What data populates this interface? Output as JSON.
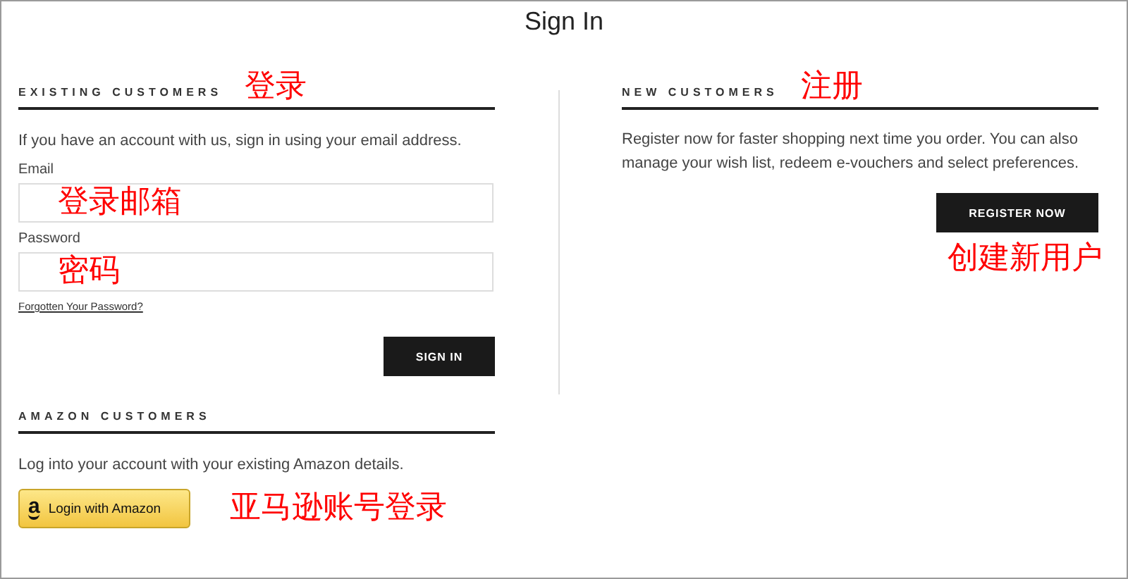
{
  "page_title": "Sign In",
  "existing": {
    "heading": "EXISTING CUSTOMERS",
    "annotation": "登录",
    "intro": "If you have an account with us, sign in using your email address.",
    "fields": [
      {
        "label": "Email",
        "annotation": "登录邮箱"
      },
      {
        "label": "Password",
        "annotation": "密码"
      }
    ],
    "forgot_link": "Forgotten Your Password?",
    "button": "SIGN IN"
  },
  "new": {
    "heading": "NEW CUSTOMERS",
    "annotation": "注册",
    "intro": "Register now for faster shopping next time you order. You can also manage your wish list, redeem e-vouchers and select preferences.",
    "button": "REGISTER NOW",
    "button_annotation": "创建新用户"
  },
  "amazon": {
    "heading": "AMAZON CUSTOMERS",
    "intro": "Log into your account with your existing Amazon details.",
    "logo_glyph": "a",
    "button": "Login with Amazon",
    "annotation": "亚马逊账号登录"
  }
}
